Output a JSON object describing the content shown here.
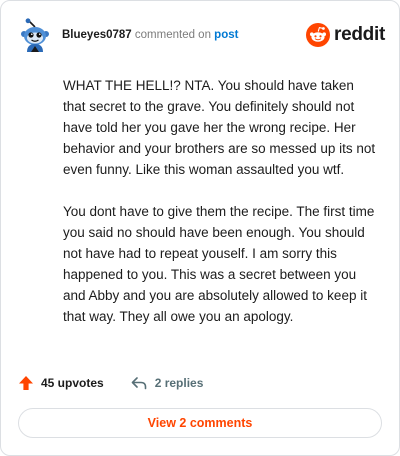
{
  "header": {
    "username": "Blueyes0787",
    "action_text": " commented on ",
    "post_link": "post",
    "avatar_icon": "snoo-avatar-icon",
    "brand_icon": "reddit-logo-icon",
    "brand_name": "reddit",
    "brand_color": "#ff4500"
  },
  "comment": {
    "paragraphs": [
      "WHAT THE HELL!? NTA. You should have taken that secret to the grave. You definitely should not have told her you gave her the wrong recipe. Her behavior and your brothers are so messed up its not even funny. Like this woman assaulted you wtf.",
      "You dont have to give them the recipe. The first time you said no should have been enough. You should not have had to repeat youself. I am sorry this happened to you. This was a secret between you and Abby and you are absolutely allowed to keep it that way. They all owe you an apology."
    ]
  },
  "stats": {
    "upvotes_icon": "upvote-arrow-icon",
    "upvotes": "45 upvotes",
    "replies_icon": "reply-arrow-icon",
    "replies": "2 replies"
  },
  "footer": {
    "view_comments_label": "View 2 comments"
  }
}
